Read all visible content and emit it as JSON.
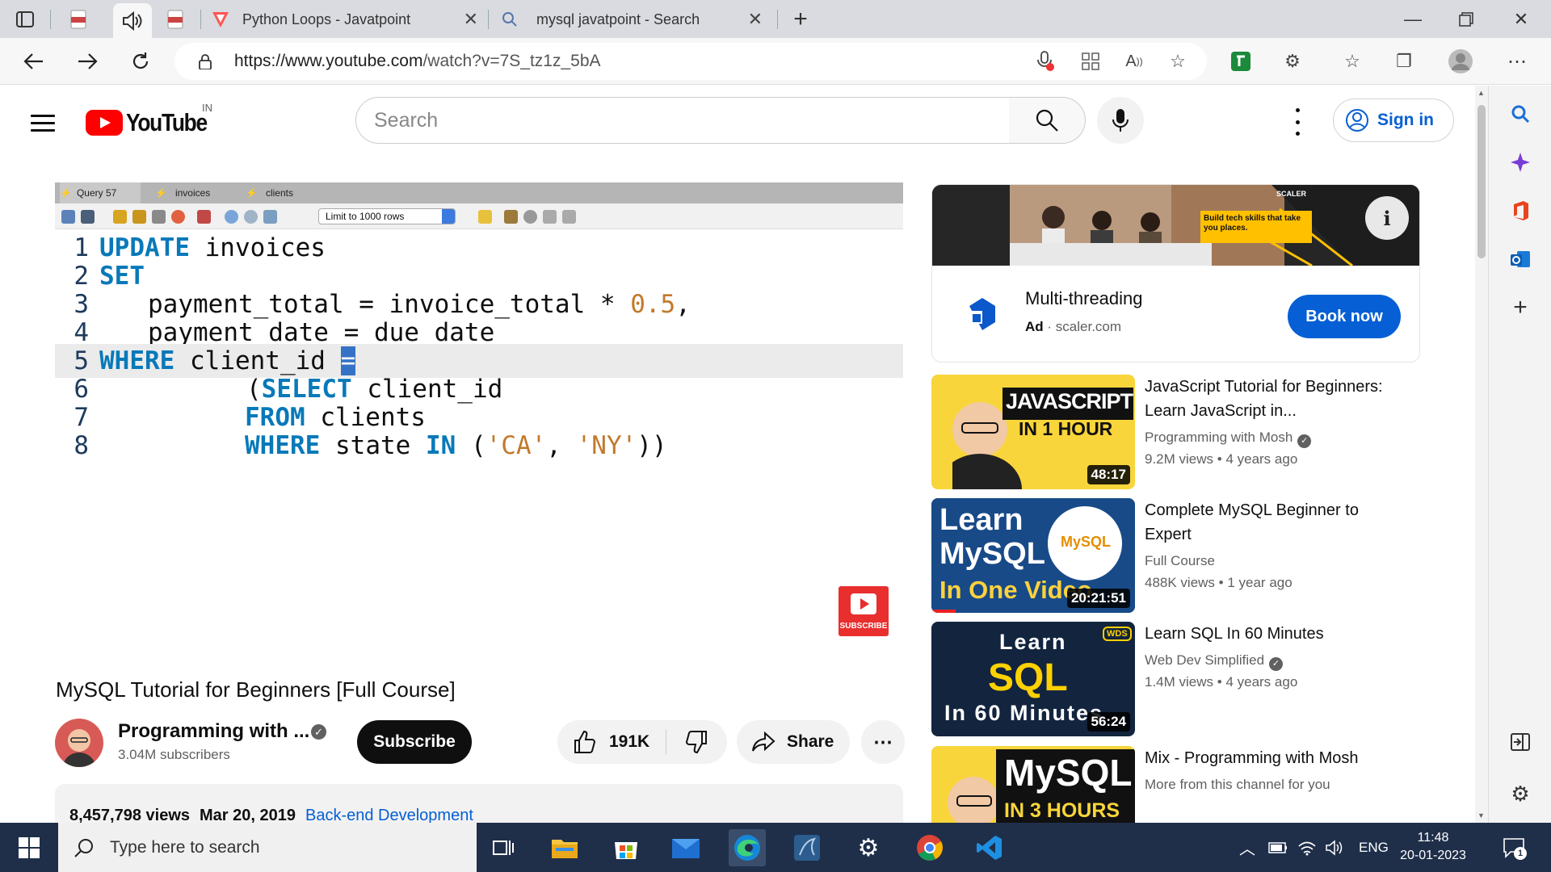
{
  "browser": {
    "tabs": [
      {
        "title": "",
        "icon": "pdf-icon"
      },
      {
        "title": "",
        "icon": "speaker-icon"
      },
      {
        "title": "",
        "icon": "pdf-icon"
      },
      {
        "title": "Python Loops - Javatpoint",
        "icon": "javatpoint-icon"
      },
      {
        "title": "mysql javatpoint - Search",
        "icon": "search-icon"
      }
    ],
    "url_host": "https://www.youtube.com",
    "url_path": "/watch?v=7S_tz1z_5bA"
  },
  "youtube": {
    "country": "IN",
    "logo_text": "YouTube",
    "search_placeholder": "Search",
    "sign_in": "Sign in"
  },
  "workbench": {
    "tabs": [
      "Query 57",
      "invoices",
      "clients"
    ],
    "limit_label": "Limit to 1000 rows",
    "line_numbers": [
      "1",
      "2",
      "3",
      "4",
      "5",
      "6",
      "7",
      "8"
    ],
    "subscribe_badge": "SUBSCRIBE"
  },
  "video": {
    "title": "MySQL Tutorial for Beginners [Full Course]",
    "channel": "Programming with ...",
    "subscribers": "3.04M subscribers",
    "subscribe_label": "Subscribe",
    "likes": "191K",
    "share_label": "Share",
    "views": "8,457,798 views",
    "date": "Mar 20, 2019",
    "tag": "Back-end Development"
  },
  "ad": {
    "brand": "SCALER",
    "banner_text": "Build tech skills that take you places.",
    "title": "Multi-threading",
    "ad_label": "Ad",
    "domain": "scaler.com",
    "cta": "Book now"
  },
  "suggestions": [
    {
      "title": "JavaScript Tutorial for Beginners: Learn JavaScript in...",
      "channel": "Programming with Mosh",
      "verified": true,
      "views": "9.2M views",
      "age": "4 years ago",
      "duration": "48:17",
      "thumb_line1": "JAVASCRIPT",
      "thumb_line2": "IN 1 HOUR"
    },
    {
      "title": "Complete MySQL Beginner to Expert",
      "channel": "Full Course",
      "verified": false,
      "views": "488K views",
      "age": "1 year ago",
      "duration": "20:21:51",
      "thumb_line1": "Learn MySQL",
      "thumb_line2": "In One Video"
    },
    {
      "title": "Learn SQL In 60 Minutes",
      "channel": "Web Dev Simplified",
      "verified": true,
      "views": "1.4M views",
      "age": "4 years ago",
      "duration": "56:24",
      "thumb_line1": "Learn",
      "thumb_line2": "SQL",
      "thumb_line3": "In 60 Minutes"
    },
    {
      "title": "Mix - Programming with Mosh",
      "channel": "More from this channel for you",
      "verified": false,
      "views": "",
      "age": "",
      "duration": "",
      "thumb_line1": "MySQL",
      "thumb_line2": "IN 3 HOURS"
    }
  ],
  "taskbar": {
    "search_placeholder": "Type here to search",
    "language": "ENG",
    "time": "11:48",
    "date": "20-01-2023",
    "notifications": "1"
  },
  "colors": {
    "youtube_red": "#ff0000",
    "link_blue": "#065fd4",
    "taskbar": "#1f2f4a",
    "sql_keyword": "#0879b9",
    "sql_string": "#c2792b"
  }
}
